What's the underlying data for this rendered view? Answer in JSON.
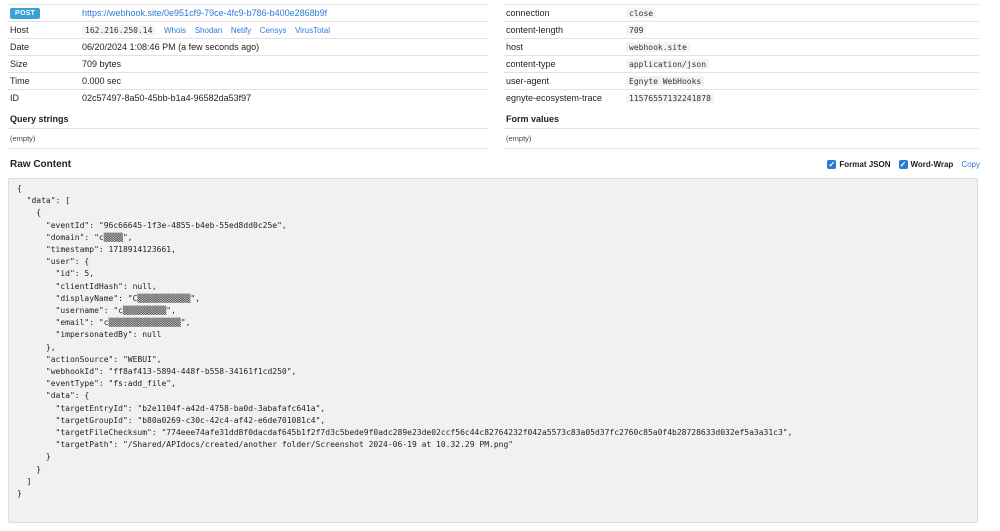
{
  "request": {
    "method": "POST",
    "url": "https://webhook.site/0e951cf9-79ce-4fc9-b786-b400e2868b9f",
    "host_label": "Host",
    "host_value": "162.216.250.14",
    "host_links": [
      "Whois",
      "Shodan",
      "Netify",
      "Censys",
      "VirusTotal"
    ],
    "date_label": "Date",
    "date_value": "06/20/2024 1:08:46 PM (a few seconds ago)",
    "size_label": "Size",
    "size_value": "709 bytes",
    "time_label": "Time",
    "time_value": "0.000 sec",
    "id_label": "ID",
    "id_value": "02c57497-8a50-45bb-b1a4-96582da53f97"
  },
  "headers": [
    {
      "key": "connection",
      "value": "close"
    },
    {
      "key": "content-length",
      "value": "709"
    },
    {
      "key": "host",
      "value": "webhook.site"
    },
    {
      "key": "content-type",
      "value": "application/json"
    },
    {
      "key": "user-agent",
      "value": "Egnyte WebHooks"
    },
    {
      "key": "egnyte-ecosystem-trace",
      "value": "11576557132241878"
    }
  ],
  "query_strings": {
    "title": "Query strings",
    "value": "(empty)"
  },
  "form_values": {
    "title": "Form values",
    "value": "(empty)"
  },
  "raw": {
    "title": "Raw Content",
    "format_json_label": "Format JSON",
    "word_wrap_label": "Word-Wrap",
    "copy_label": "Copy",
    "content": "{\n  \"data\": [\n    {\n      \"eventId\": \"96c66645-1f3e-4855-b4eb-55ed8dd0c25e\",\n      \"domain\": \"c▒▒▒▒\",\n      \"timestamp\": 1718914123661,\n      \"user\": {\n        \"id\": 5,\n        \"clientIdHash\": null,\n        \"displayName\": \"C▒▒▒▒▒▒▒▒▒▒▒\",\n        \"username\": \"c▒▒▒▒▒▒▒▒▒\",\n        \"email\": \"c▒▒▒▒▒▒▒▒▒▒▒▒▒▒▒\",\n        \"impersonatedBy\": null\n      },\n      \"actionSource\": \"WEBUI\",\n      \"webhookId\": \"ff8af413-5894-448f-b558-34161f1cd250\",\n      \"eventType\": \"fs:add_file\",\n      \"data\": {\n        \"targetEntryId\": \"b2e1104f-a42d-4758-ba0d-3abafafc641a\",\n        \"targetGroupId\": \"b80a0269-c30c-42c4-af42-e6de701081c4\",\n        \"targetFileChecksum\": \"774eee74afe31dd8f0dacdaf645b1f2f7d3c5bede9f0adc289e23de02ccf56c44c82764232f042a5573c83a05d37fc2760c85a0f4b28728633d032ef5a3a31c3\",\n        \"targetPath\": \"/Shared/APIdocs/created/another folder/Screenshot 2024-06-19 at 10.32.29 PM.png\"\n      }\n    }\n  ]\n}"
  }
}
